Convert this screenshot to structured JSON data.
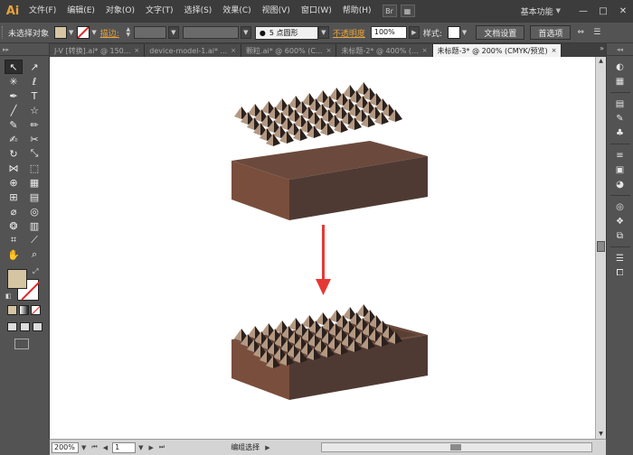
{
  "app": {
    "logo": "Ai",
    "menu": [
      "文件(F)",
      "编辑(E)",
      "对象(O)",
      "文字(T)",
      "选择(S)",
      "效果(C)",
      "视图(V)",
      "窗口(W)",
      "帮助(H)"
    ],
    "workspace": "基本功能",
    "window_controls": [
      "—",
      "□",
      "✕"
    ]
  },
  "controlbar": {
    "selection_label": "未选择对象",
    "fill_color": "#d6c5a2",
    "stroke_label": "描边:",
    "brush_label": "5 点圆形",
    "opacity_label": "不透明度",
    "opacity_value": "100%",
    "style_label": "样式:",
    "doc_settings": "文档设置",
    "preferences": "首选项"
  },
  "tabs": [
    {
      "label": "J-V [转换].ai* @ 150...",
      "active": false
    },
    {
      "label": "device-model-1.ai* ...",
      "active": false
    },
    {
      "label": "颗粒.ai* @ 600% (C...",
      "active": false
    },
    {
      "label": "未标题-2* @ 400% (...",
      "active": false
    },
    {
      "label": "未标题-3* @ 200% (CMYK/预览)",
      "active": true
    }
  ],
  "tools": [
    {
      "name": "selection-tool",
      "glyph": "↖",
      "active": true
    },
    {
      "name": "direct-selection-tool",
      "glyph": "↗",
      "active": false
    },
    {
      "name": "magic-wand-tool",
      "glyph": "✳",
      "active": false
    },
    {
      "name": "lasso-tool",
      "glyph": "ℓ",
      "active": false
    },
    {
      "name": "pen-tool",
      "glyph": "✒",
      "active": false
    },
    {
      "name": "type-tool",
      "glyph": "T",
      "active": false
    },
    {
      "name": "line-tool",
      "glyph": "╱",
      "active": false
    },
    {
      "name": "star-tool",
      "glyph": "☆",
      "active": false
    },
    {
      "name": "paintbrush-tool",
      "glyph": "✎",
      "active": false
    },
    {
      "name": "pencil-tool",
      "glyph": "✏",
      "active": false
    },
    {
      "name": "blob-brush-tool",
      "glyph": "✍",
      "active": false
    },
    {
      "name": "scissors-tool",
      "glyph": "✂",
      "active": false
    },
    {
      "name": "rotate-tool",
      "glyph": "↻",
      "active": false
    },
    {
      "name": "scale-tool",
      "glyph": "⤡",
      "active": false
    },
    {
      "name": "width-tool",
      "glyph": "⋈",
      "active": false
    },
    {
      "name": "free-transform-tool",
      "glyph": "⬚",
      "active": false
    },
    {
      "name": "shape-builder-tool",
      "glyph": "⊕",
      "active": false
    },
    {
      "name": "perspective-grid-tool",
      "glyph": "▦",
      "active": false
    },
    {
      "name": "mesh-tool",
      "glyph": "⊞",
      "active": false
    },
    {
      "name": "gradient-tool",
      "glyph": "▤",
      "active": false
    },
    {
      "name": "eyedropper-tool",
      "glyph": "⌀",
      "active": false
    },
    {
      "name": "blend-tool",
      "glyph": "◎",
      "active": false
    },
    {
      "name": "symbol-sprayer-tool",
      "glyph": "❂",
      "active": false
    },
    {
      "name": "column-graph-tool",
      "glyph": "▥",
      "active": false
    },
    {
      "name": "artboard-tool",
      "glyph": "⌗",
      "active": false
    },
    {
      "name": "slice-tool",
      "glyph": "⟋",
      "active": false
    },
    {
      "name": "hand-tool",
      "glyph": "✋",
      "active": false
    },
    {
      "name": "zoom-tool",
      "glyph": "⌕",
      "active": false
    }
  ],
  "colors": {
    "fill": "#d6c5a2",
    "stroke": "none",
    "box_top": "#6b4a3d",
    "box_front": "#7a4e3c",
    "box_side": "#4f3a33",
    "arrow": "#e53935"
  },
  "status": {
    "zoom": "200%",
    "page": "1",
    "text": "编组选择"
  }
}
